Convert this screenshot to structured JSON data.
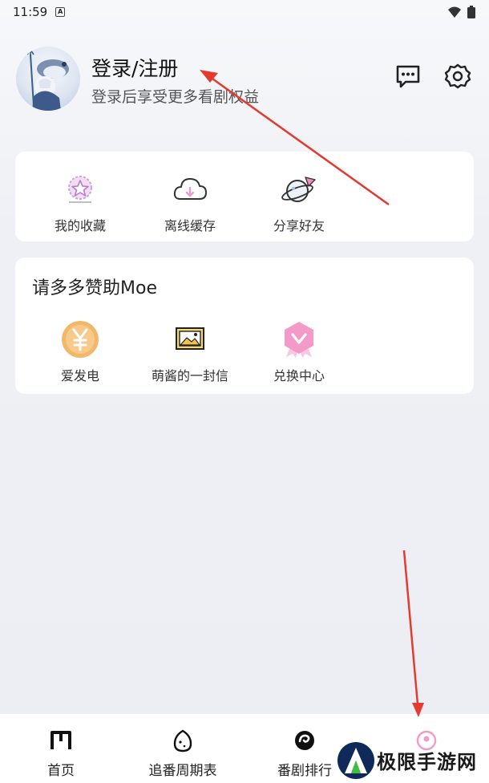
{
  "status_bar": {
    "time": "11:59",
    "a_badge": "A"
  },
  "profile": {
    "title": "登录/注册",
    "subtitle": "登录后享受更多看剧权益"
  },
  "top_icons": {
    "message": "message-icon",
    "settings": "gear-icon"
  },
  "quick_actions": [
    {
      "label": "我的收藏",
      "icon": "favorite-star-icon"
    },
    {
      "label": "离线缓存",
      "icon": "cloud-download-icon"
    },
    {
      "label": "分享好友",
      "icon": "share-planet-icon"
    }
  ],
  "support": {
    "title": "请多多赞助Moe",
    "items": [
      {
        "label": "爱发电",
        "icon": "yen-coin-icon"
      },
      {
        "label": "萌酱的一封信",
        "icon": "letter-picture-icon"
      },
      {
        "label": "兑换中心",
        "icon": "exchange-badge-icon"
      }
    ]
  },
  "bottom_nav": [
    {
      "label": "首页",
      "icon": "home-m-icon"
    },
    {
      "label": "追番周期表",
      "icon": "egg-icon"
    },
    {
      "label": "番剧排行",
      "icon": "ranking-swirl-icon"
    },
    {
      "label": "",
      "icon": "profile-icon"
    }
  ],
  "watermark": {
    "text": "极限手游网"
  },
  "colors": {
    "accent_pink": "#f49ac8",
    "arrow_red": "#e53a2f",
    "coin_orange": "#f2b86a"
  }
}
